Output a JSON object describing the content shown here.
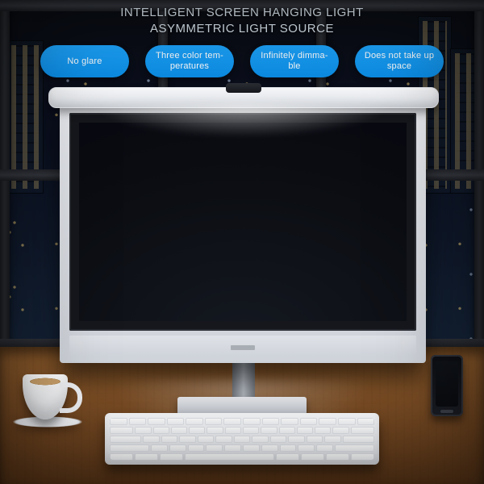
{
  "heading": {
    "line1": "INTELLIGENT SCREEN HANGING LIGHT",
    "line2": "ASYMMETRIC LIGHT SOURCE"
  },
  "features": [
    {
      "label": "No glare"
    },
    {
      "label": "Three color tem-\nperatures"
    },
    {
      "label": "Infinitely dimma-\nble"
    },
    {
      "label": "Does not take up\nspace"
    }
  ],
  "colors": {
    "pill": "#1ea6ff"
  }
}
